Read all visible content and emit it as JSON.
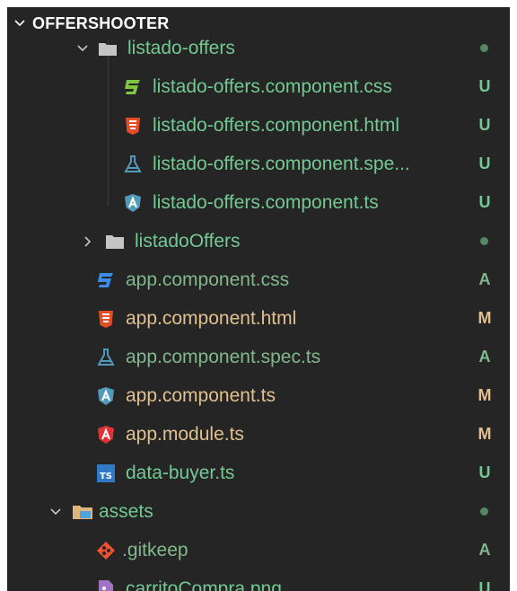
{
  "explorer": {
    "title": "OFFERSHOOTER"
  },
  "rows": [
    {
      "label": "listado-offers",
      "badge": "",
      "icon": "folder-open-icon"
    },
    {
      "label": "listado-offers.component.css",
      "badge": "U",
      "icon": "css-icon"
    },
    {
      "label": "listado-offers.component.html",
      "badge": "U",
      "icon": "html-icon"
    },
    {
      "label": "listado-offers.component.spe...",
      "badge": "U",
      "icon": "test-flask-icon"
    },
    {
      "label": "listado-offers.component.ts",
      "badge": "U",
      "icon": "angular-component-icon"
    },
    {
      "label": "listadoOffers",
      "badge": "",
      "icon": "folder-icon"
    },
    {
      "label": "app.component.css",
      "badge": "A",
      "icon": "css-icon"
    },
    {
      "label": "app.component.html",
      "badge": "M",
      "icon": "html-icon"
    },
    {
      "label": "app.component.spec.ts",
      "badge": "A",
      "icon": "test-flask-icon"
    },
    {
      "label": "app.component.ts",
      "badge": "M",
      "icon": "angular-component-icon"
    },
    {
      "label": "app.module.ts",
      "badge": "M",
      "icon": "angular-module-icon"
    },
    {
      "label": "data-buyer.ts",
      "badge": "U",
      "icon": "typescript-icon"
    },
    {
      "label": "assets",
      "badge": "",
      "icon": "folder-assets-icon"
    },
    {
      "label": ".gitkeep",
      "badge": "A",
      "icon": "git-icon"
    },
    {
      "label": "carritoCompra.png",
      "badge": "U",
      "icon": "image-icon"
    }
  ],
  "colors": {
    "untracked": "#73c991",
    "added": "#81b88b",
    "modified": "#e2c08d",
    "background": "#252526"
  }
}
